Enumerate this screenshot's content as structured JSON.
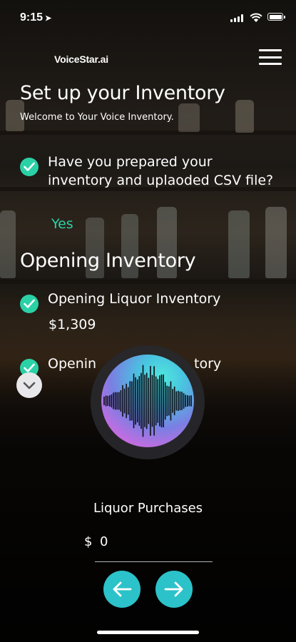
{
  "status_bar": {
    "time": "9:15"
  },
  "header": {
    "logo_text": "VoiceStar.ai"
  },
  "page": {
    "title": "Set up your Inventory",
    "subtitle": "Welcome to Your Voice Inventory."
  },
  "prepared_question": {
    "text": "Have you prepared your inventory and uplaoded CSV file?",
    "answer": "Yes"
  },
  "opening_inventory": {
    "heading": "Opening Inventory",
    "items": [
      {
        "label": "Opening Liquor Inventory",
        "value": "$1,309"
      },
      {
        "label": "Openin",
        "label_end": "tory"
      }
    ]
  },
  "purchases": {
    "label": "Liquor Purchases",
    "currency": "$",
    "value": "0"
  },
  "colors": {
    "accent": "#2ad1a6",
    "nav_button": "#2cc2c9"
  },
  "icons": [
    "location-arrow-icon",
    "signal-icon",
    "wifi-icon",
    "battery-icon",
    "voicestar-logo-icon",
    "hamburger-menu-icon",
    "checkmark-icon",
    "voice-waveform-icon",
    "chevron-down-icon",
    "arrow-left-icon",
    "arrow-right-icon"
  ]
}
